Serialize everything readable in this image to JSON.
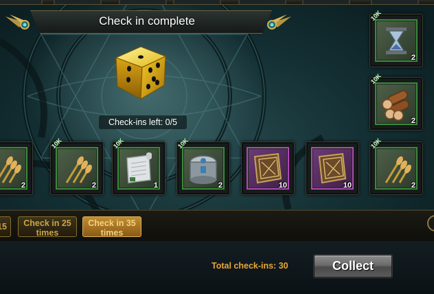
{
  "title": "Check in complete",
  "checkins_left": "Check-ins left: 0/5",
  "rewards": [
    {
      "icon": "wheat-icon",
      "badge": "",
      "count": "2"
    },
    {
      "icon": "wheat-icon",
      "badge": "10K",
      "count": "2"
    },
    {
      "icon": "scroll-icon",
      "badge": "10K",
      "count": "1"
    },
    {
      "icon": "silver-chest-icon",
      "badge": "10K",
      "count": "2"
    },
    {
      "icon": "spellbook-icon",
      "badge": "",
      "count": "10"
    },
    {
      "icon": "spellbook-icon",
      "badge": "",
      "count": "10"
    },
    {
      "icon": "wheat-icon",
      "badge": "10K",
      "count": "2"
    },
    {
      "icon": "logs-icon",
      "badge": "10K",
      "count": "2"
    },
    {
      "icon": "hourglass-icon",
      "badge": "10K",
      "count": "2"
    }
  ],
  "tabs": [
    {
      "label": "15",
      "active": false
    },
    {
      "label": "Check in 25 times",
      "active": false
    },
    {
      "label": "Check in 35 times",
      "active": true
    }
  ],
  "footer": {
    "total_label": "Total check-ins: 30",
    "collect_label": "Collect"
  },
  "colors": {
    "accent_gold": "#e8a737",
    "green_frame": "#3c8a3c",
    "purple_frame": "#b348b8"
  }
}
